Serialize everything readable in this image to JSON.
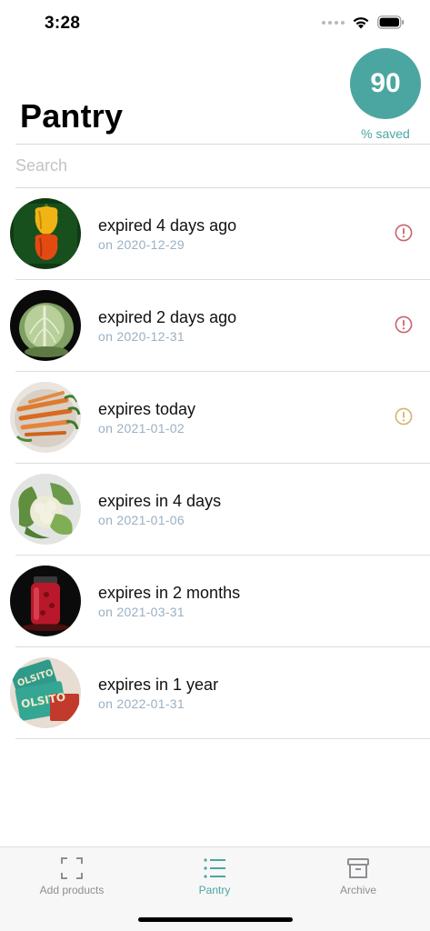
{
  "status_bar": {
    "time": "3:28"
  },
  "header": {
    "title": "Pantry",
    "score_value": "90",
    "score_label": "% saved",
    "accent_color": "#4ba6a2"
  },
  "search": {
    "placeholder": "Search",
    "value": ""
  },
  "items": [
    {
      "title": "expired 4 days ago",
      "date": "on 2020-12-29",
      "image": "yellow-red-peppers",
      "alert": "expired",
      "alert_color": "#c9636a"
    },
    {
      "title": "expired 2 days ago",
      "date": "on 2020-12-31",
      "image": "cabbage",
      "alert": "expired",
      "alert_color": "#c9636a"
    },
    {
      "title": "expires today",
      "date": "on 2021-01-02",
      "image": "carrots",
      "alert": "warning",
      "alert_color": "#d7b36a"
    },
    {
      "title": "expires in 4 days",
      "date": "on 2021-01-06",
      "image": "cauliflower",
      "alert": "none"
    },
    {
      "title": "expires in 2 months",
      "date": "on 2021-03-31",
      "image": "pickle-jar",
      "alert": "none"
    },
    {
      "title": "expires in 1 year",
      "date": "on 2022-01-31",
      "image": "snack-packs",
      "alert": "none"
    }
  ],
  "tab_bar": {
    "tabs": [
      {
        "label": "Add products",
        "icon": "scan-icon",
        "active": false
      },
      {
        "label": "Pantry",
        "icon": "list-icon",
        "active": true
      },
      {
        "label": "Archive",
        "icon": "archive-box-icon",
        "active": false
      }
    ]
  }
}
